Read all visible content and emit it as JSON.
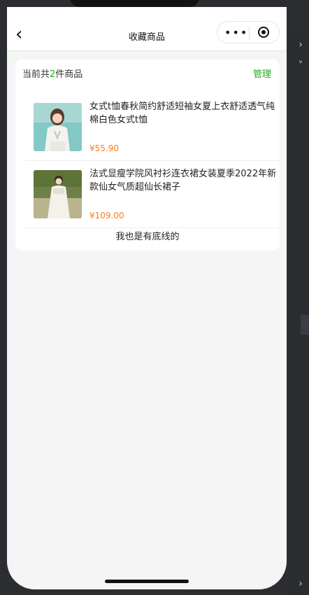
{
  "navbar": {
    "title": "收藏商品"
  },
  "summary": {
    "prefix": "当前共",
    "count": "2",
    "suffix": "件商品",
    "manage_label": "管理"
  },
  "items": [
    {
      "title": "女式t恤春秋简约舒适短袖女夏上衣舒适透气纯棉白色女式t恤",
      "price": "¥55.90"
    },
    {
      "title": "法式显瘦学院风衬衫连衣裙女装夏季2022年新款仙女气质超仙长裙子",
      "price": "¥109.00"
    }
  ],
  "footer": {
    "text": "我也是有底线的"
  }
}
